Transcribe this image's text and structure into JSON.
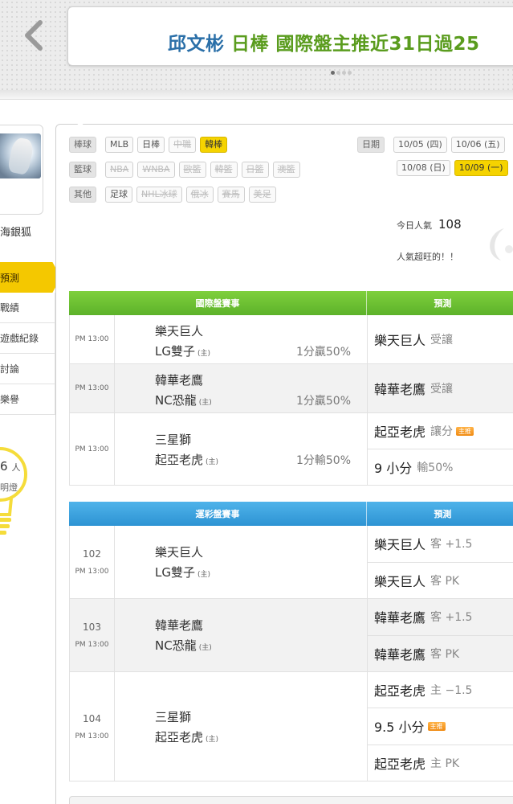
{
  "header": {
    "name": "邱文彬",
    "sport": "日棒",
    "headline": "國際盤主推近31日過25"
  },
  "sidebar": {
    "username": "海銀狐",
    "nav": [
      "預測",
      "戰績",
      "遊戲紀錄",
      "討論",
      "樂譽"
    ],
    "bulb_count": "6",
    "bulb_unit": "人",
    "bulb_label": "明燈"
  },
  "filters": {
    "rows": [
      {
        "category": "棒球",
        "tags": [
          {
            "label": "MLB",
            "state": "normal"
          },
          {
            "label": "日棒",
            "state": "normal"
          },
          {
            "label": "中職",
            "state": "disabled"
          },
          {
            "label": "韓棒",
            "state": "selected"
          }
        ]
      },
      {
        "category": "籃球",
        "tags": [
          {
            "label": "NBA",
            "state": "disabled"
          },
          {
            "label": "WNBA",
            "state": "disabled"
          },
          {
            "label": "歐籃",
            "state": "disabled"
          },
          {
            "label": "韓籃",
            "state": "disabled"
          },
          {
            "label": "日籃",
            "state": "disabled"
          },
          {
            "label": "澳籃",
            "state": "disabled"
          }
        ]
      },
      {
        "category": "其他",
        "tags": [
          {
            "label": "足球",
            "state": "normal"
          },
          {
            "label": "NHL冰球",
            "state": "disabled"
          },
          {
            "label": "俄冰",
            "state": "disabled"
          },
          {
            "label": "賽馬",
            "state": "disabled"
          },
          {
            "label": "美足",
            "state": "disabled"
          }
        ]
      }
    ]
  },
  "dates": {
    "label": "日期",
    "row1": [
      {
        "label": "10/05 (四)",
        "state": "normal"
      },
      {
        "label": "10/06 (五)",
        "state": "normal"
      }
    ],
    "row2": [
      {
        "label": "10/08 (日)",
        "state": "normal"
      },
      {
        "label": "10/09 (一)",
        "state": "selected"
      }
    ]
  },
  "popularity": {
    "label": "今日人氣",
    "value": "108",
    "message": "人氣超旺的！！"
  },
  "intl_table": {
    "col1": "國際盤賽事",
    "col2": "預測",
    "rows": [
      {
        "time": "PM 13:00",
        "team1": "樂天巨人",
        "team2": "LG雙子",
        "home": "(主)",
        "odds": "1分贏50%",
        "preds": [
          {
            "main": "樂天巨人",
            "sub": "受讓",
            "badge": ""
          }
        ]
      },
      {
        "time": "PM 13:00",
        "team1": "韓華老鷹",
        "team2": "NC恐龍",
        "home": "(主)",
        "odds": "1分贏50%",
        "preds": [
          {
            "main": "韓華老鷹",
            "sub": "受讓",
            "badge": ""
          }
        ]
      },
      {
        "time": "PM 13:00",
        "team1": "三星獅",
        "team2": "起亞老虎",
        "home": "(主)",
        "odds": "1分輸50%",
        "preds": [
          {
            "main": "起亞老虎",
            "sub": "讓分",
            "badge": "主推"
          },
          {
            "main": "9 小分",
            "sub": "輸50%",
            "badge": ""
          }
        ]
      }
    ]
  },
  "sports_table": {
    "col1": "運彩盤賽事",
    "col2": "預測",
    "rows": [
      {
        "no": "102",
        "time": "PM 13:00",
        "team1": "樂天巨人",
        "team2": "LG雙子",
        "home": "(主)",
        "preds": [
          {
            "main": "樂天巨人",
            "sub": "客 +1.5",
            "badge": ""
          },
          {
            "main": "樂天巨人",
            "sub": "客 PK",
            "badge": ""
          }
        ]
      },
      {
        "no": "103",
        "time": "PM 13:00",
        "team1": "韓華老鷹",
        "team2": "NC恐龍",
        "home": "(主)",
        "preds": [
          {
            "main": "韓華老鷹",
            "sub": "客 +1.5",
            "badge": ""
          },
          {
            "main": "韓華老鷹",
            "sub": "客 PK",
            "badge": ""
          }
        ]
      },
      {
        "no": "104",
        "time": "PM 13:00",
        "team1": "三星獅",
        "team2": "起亞老虎",
        "home": "(主)",
        "preds": [
          {
            "main": "起亞老虎",
            "sub": "主 −1.5",
            "badge": ""
          },
          {
            "main": "9.5 小分",
            "sub": "",
            "badge": "主推"
          },
          {
            "main": "起亞老虎",
            "sub": "主 PK",
            "badge": ""
          }
        ]
      }
    ]
  },
  "colors": {
    "accent_yellow": "#f4c800",
    "intl_header": "#5cb22a",
    "sports_header": "#2d93d3",
    "badge_orange": "#f08a12"
  }
}
